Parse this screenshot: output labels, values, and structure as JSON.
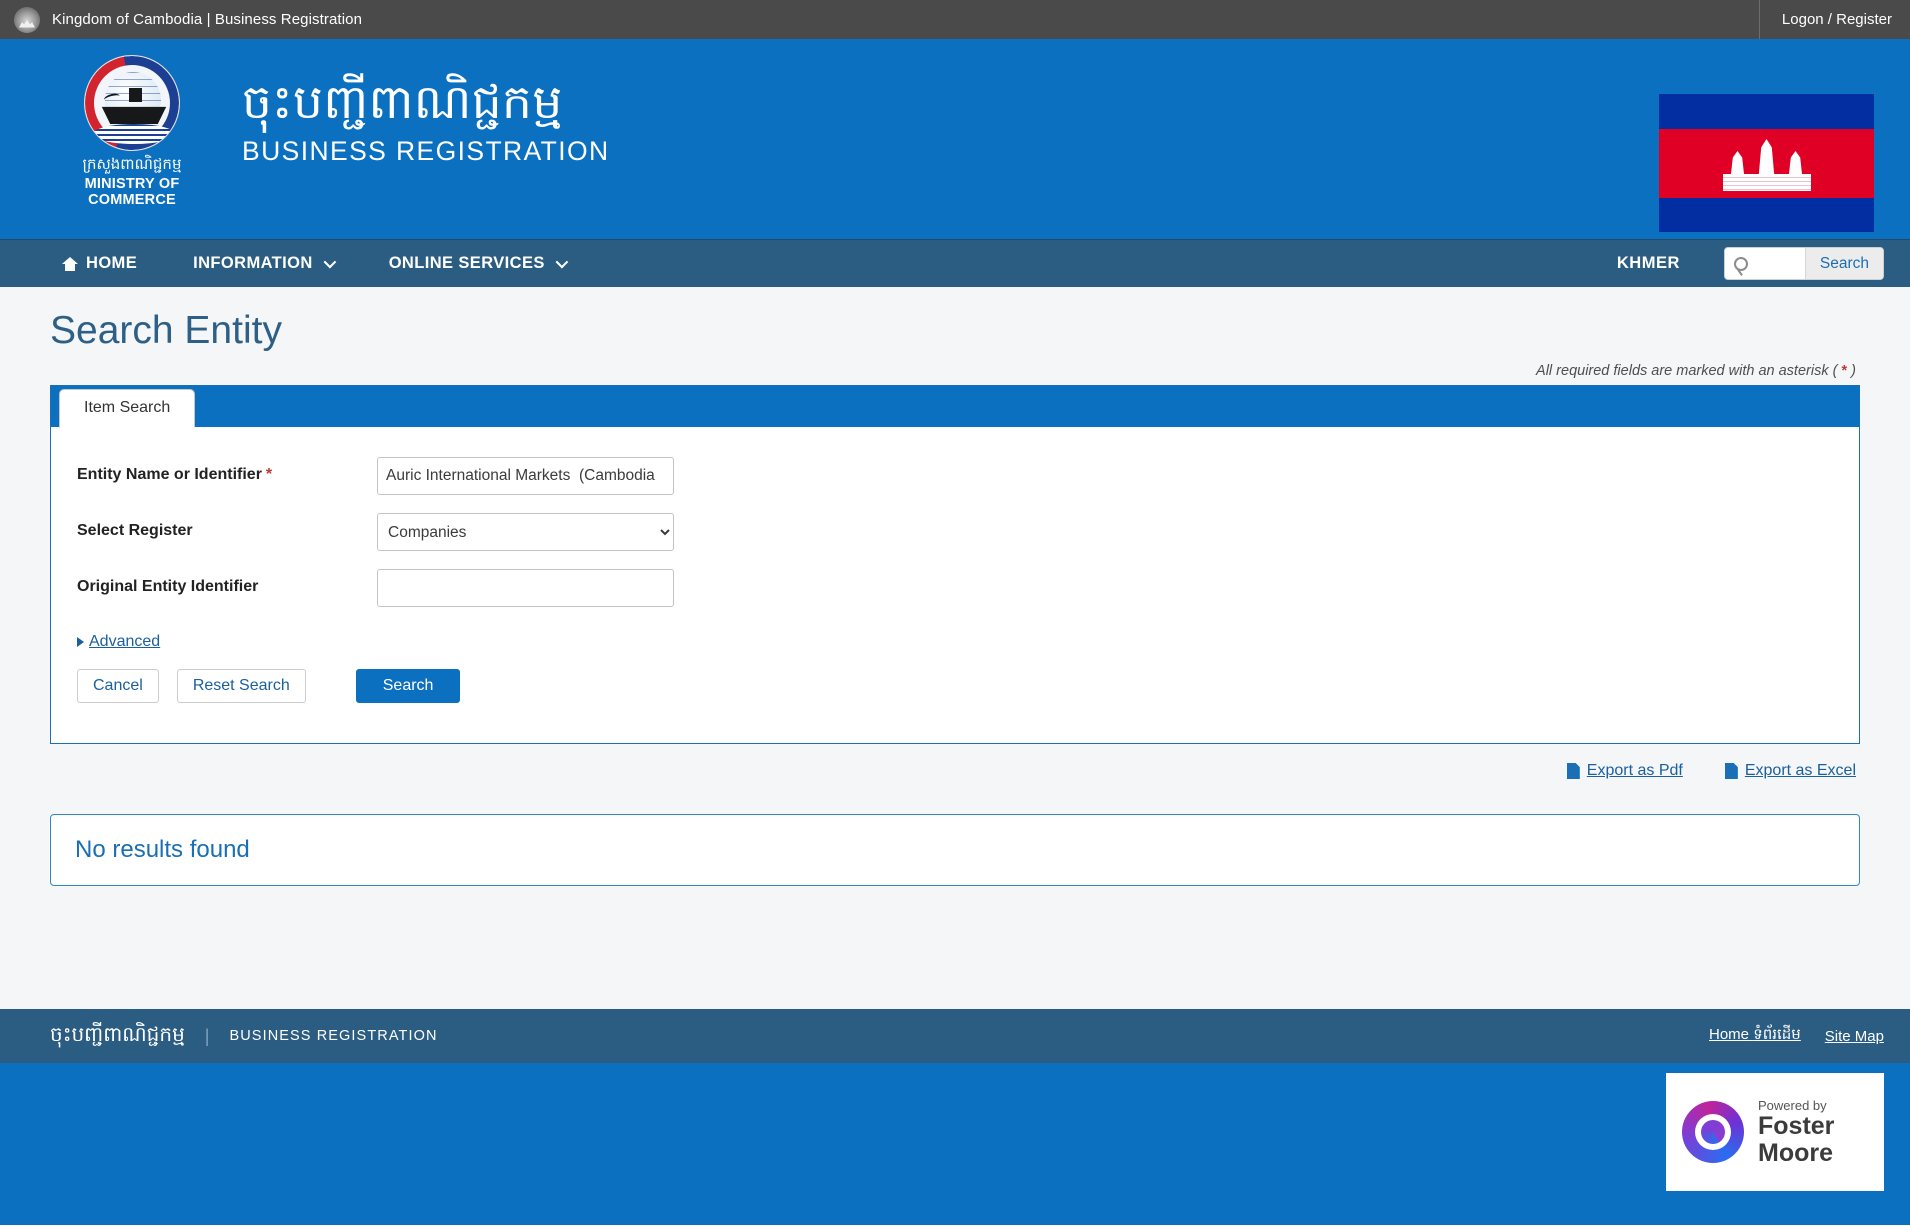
{
  "topbar": {
    "crest_icon": "cambodia-crest-icon",
    "title": "Kingdom of Cambodia | Business Registration",
    "logon_label": "Logon / Register"
  },
  "masthead": {
    "ministry_kh": "ក្រសួងពាណិជ្ជកម្ម",
    "ministry_en": "MINISTRY OF COMMERCE",
    "site_kh": "ចុះបញ្ជីពាណិជ្ជកម្ម",
    "site_en": "BUSINESS REGISTRATION",
    "flag_alt": "cambodia-flag-icon"
  },
  "nav": {
    "items": [
      {
        "label": "HOME",
        "icon": "home-icon",
        "has_caret": false
      },
      {
        "label": "INFORMATION",
        "icon": "",
        "has_caret": true
      },
      {
        "label": "ONLINE SERVICES",
        "icon": "",
        "has_caret": true
      }
    ],
    "language_label": "KHMER",
    "search_placeholder": "",
    "search_value": "",
    "search_button_label": "Search",
    "search_icon": "search-icon"
  },
  "page": {
    "title": "Search Entity",
    "required_note_prefix": "All required fields are marked with an asterisk (",
    "required_note_asterisk": "*",
    "required_note_suffix": ")"
  },
  "tabs": [
    {
      "label": "Item Search",
      "active": true
    }
  ],
  "form": {
    "fields": [
      {
        "label": "Entity Name or Identifier",
        "required": true,
        "required_mark": "*",
        "type": "text",
        "value": "Auric International Markets  (Cambodia",
        "placeholder": ""
      },
      {
        "label": "Select Register",
        "required": false,
        "required_mark": "",
        "type": "select",
        "value": "Companies",
        "options": [
          "Companies"
        ]
      },
      {
        "label": "Original Entity Identifier",
        "required": false,
        "required_mark": "",
        "type": "text",
        "value": "",
        "placeholder": ""
      }
    ],
    "advanced_label": "Advanced",
    "buttons": {
      "cancel": "Cancel",
      "reset": "Reset Search",
      "search": "Search"
    }
  },
  "export": {
    "pdf_label": "Export as Pdf",
    "excel_label": "Export as Excel",
    "icon": "file-icon"
  },
  "results": {
    "message": "No results found"
  },
  "footer": {
    "kh": "ចុះបញ្ជីពាណិជ្ជកម្ម",
    "divider": "|",
    "en": "BUSINESS REGISTRATION",
    "home_label": "Home",
    "home_label_kh": "ទំព័រដើម",
    "sitemap_label": "Site Map"
  },
  "foster_moore": {
    "powered_by": "Powered by",
    "name_line1": "Foster",
    "name_line2": "Moore",
    "logo_icon": "foster-moore-logo-icon"
  },
  "colors": {
    "brand_blue": "#0c70c0",
    "nav_blue": "#2b5d82",
    "topbar_gray": "#4a4a4a",
    "link_blue": "#1a5f9e",
    "required_red": "#c0392b",
    "title_blue": "#2e6087"
  }
}
